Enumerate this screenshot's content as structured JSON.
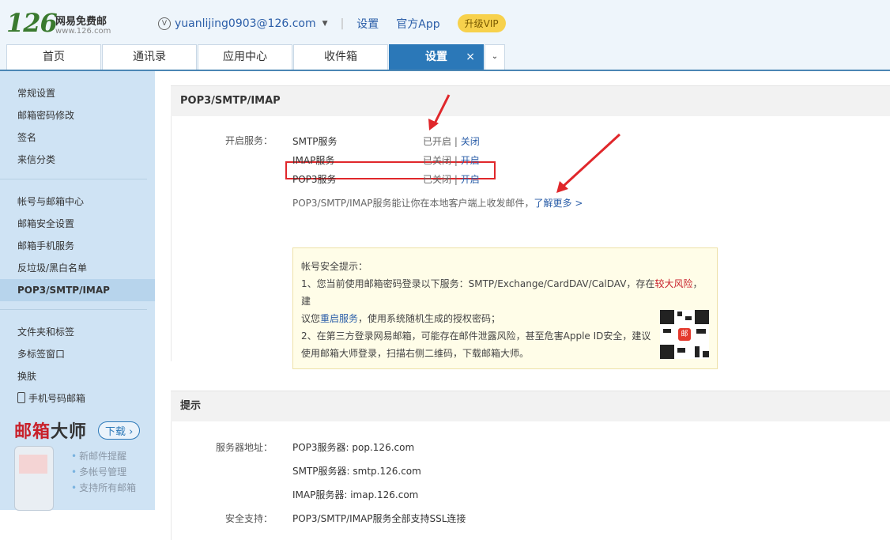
{
  "header": {
    "logo_number": "126",
    "logo_title": "网易免费邮",
    "logo_domain": "www.126.com",
    "account_icon": "V",
    "account_email": "yuanlijing0903@126.com",
    "settings_link": "设置",
    "app_link": "官方App",
    "vip_button": "升级VIP"
  },
  "tabs": [
    {
      "label": "首页"
    },
    {
      "label": "通讯录"
    },
    {
      "label": "应用中心"
    },
    {
      "label": "收件箱"
    },
    {
      "label": "设置",
      "close": "×"
    }
  ],
  "tab_more": "⌄",
  "sidebar": {
    "group1": [
      "常规设置",
      "邮箱密码修改",
      "签名",
      "来信分类"
    ],
    "group2": [
      "帐号与邮箱中心",
      "邮箱安全设置",
      "邮箱手机服务",
      "反垃圾/黑白名单",
      "POP3/SMTP/IMAP"
    ],
    "group3": [
      "文件夹和标签",
      "多标签窗口",
      "换肤"
    ],
    "phone_item": "手机号码邮箱",
    "promo": {
      "title_red": "邮箱",
      "title_dark": "大师",
      "download": "下载 ›",
      "features": [
        "新邮件提醒",
        "多帐号管理",
        "支持所有邮箱"
      ]
    }
  },
  "pop_panel": {
    "title": "POP3/SMTP/IMAP",
    "open_service_label": "开启服务：",
    "services": [
      {
        "name": "SMTP服务",
        "status": "已开启",
        "sep": "|",
        "action": "关闭"
      },
      {
        "name": "IMAP服务",
        "status": "已关闭",
        "sep": "|",
        "action": "开启"
      },
      {
        "name": "POP3服务",
        "status": "已关闭",
        "sep": "|",
        "action": "开启"
      }
    ],
    "desc": "POP3/SMTP/IMAP服务能让你在本地客户端上收发邮件，",
    "learn_more": "了解更多 >",
    "tip": {
      "title": "帐号安全提示：",
      "line1_a": "1、您当前使用邮箱密码登录以下服务：SMTP/Exchange/CardDAV/CalDAV，存在",
      "line1_red": "较大风险",
      "line1_b": "，建",
      "line2_a": "议您",
      "line2_link": "重启服务",
      "line2_b": "，使用系统随机生成的授权密码；",
      "line3": "2、在第三方登录网易邮箱，可能存在邮件泄露风险，甚至危害Apple ID安全，建议",
      "line4": "使用邮箱大师登录，扫描右侧二维码，下载邮箱大师。",
      "qr_center": "邮"
    }
  },
  "hint_panel": {
    "title": "提示",
    "server_label": "服务器地址：",
    "servers": [
      "POP3服务器: pop.126.com",
      "SMTP服务器: smtp.126.com",
      "IMAP服务器: imap.126.com"
    ],
    "security_label": "安全支持：",
    "security_text": "POP3/SMTP/IMAP服务全部支持SSL连接"
  },
  "colors": {
    "accent": "#2b78b8",
    "annotation_red": "#e0272b",
    "link": "#2b5ea8",
    "sidebar_bg": "#cfe3f4"
  }
}
